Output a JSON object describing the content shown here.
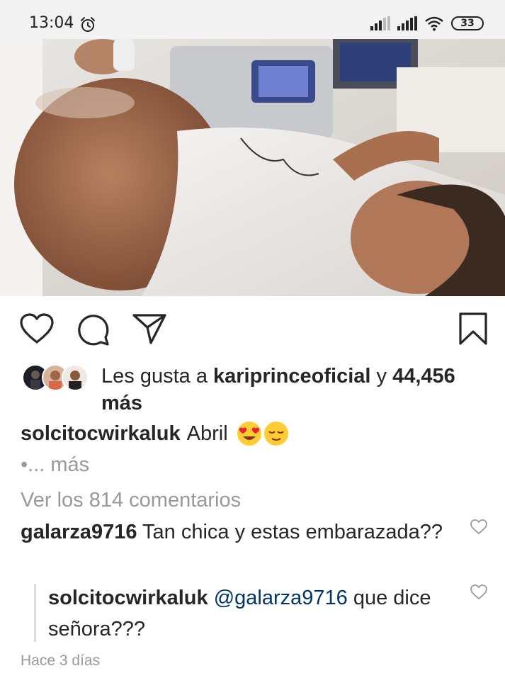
{
  "status_bar": {
    "time": "13:04",
    "battery": "33",
    "icons": [
      "alarm-icon",
      "signal-icon",
      "signal-icon",
      "wifi-icon",
      "battery-icon"
    ]
  },
  "post": {
    "image_description_icon": "photo",
    "actions": [
      "heart-icon",
      "comment-icon",
      "share-icon",
      "bookmark-icon"
    ],
    "likes": {
      "prefix": "Les gusta a",
      "user": "kariprinceoficial",
      "conjunction": "y",
      "count": "44,456",
      "suffix": "más"
    },
    "caption": {
      "user": "solcitocwirkaluk",
      "text": "Abril",
      "emojis": [
        "heart-eyes-emoji",
        "relieved-emoji"
      ]
    },
    "more_label": "•... más",
    "view_comments": "Ver los 814 comentarios",
    "comments": [
      {
        "user": "galarza9716",
        "text": "Tan chica y estas embarazada??"
      }
    ],
    "reply": {
      "user": "solcitocwirkaluk",
      "mention": "@galarza9716",
      "text": "que dice señora???"
    },
    "timestamp": "Hace 3 días"
  },
  "colors": {
    "text": "#262626",
    "muted": "#999999",
    "mention": "#003569",
    "status_bg": "#f2f2f2"
  }
}
